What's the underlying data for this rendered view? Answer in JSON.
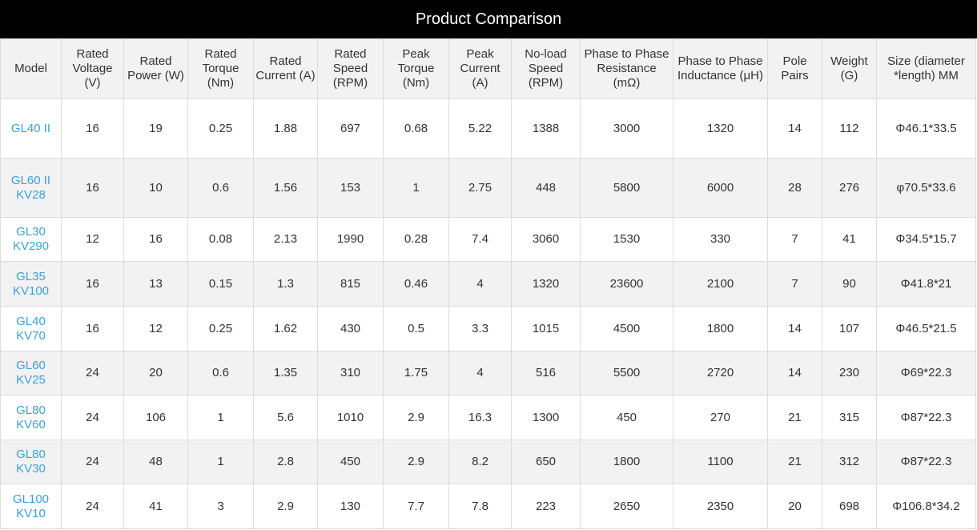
{
  "title": "Product Comparison",
  "colors": {
    "header_bg": "#000000",
    "model_link": "#3aa0d8",
    "stripe": "#f2f2f2"
  },
  "columns": [
    "Model",
    "Rated Voltage (V)",
    "Rated Power (W)",
    "Rated Torque (Nm)",
    "Rated Current (A)",
    "Rated Speed (RPM)",
    "Peak Torque (Nm)",
    "Peak Current (A)",
    "No-load Speed (RPM)",
    "Phase to Phase Resistance (mΩ)",
    "Phase to Phase Inductance (μH)",
    "Pole Pairs",
    "Weight (G)",
    "Size (diameter *length) MM"
  ],
  "rows": [
    [
      "GL40 II",
      "16",
      "19",
      "0.25",
      "1.88",
      "697",
      "0.68",
      "5.22",
      "1388",
      "3000",
      "1320",
      "14",
      "112",
      "Φ46.1*33.5"
    ],
    [
      "GL60 II KV28",
      "16",
      "10",
      "0.6",
      "1.56",
      "153",
      "1",
      "2.75",
      "448",
      "5800",
      "6000",
      "28",
      "276",
      "φ70.5*33.6"
    ],
    [
      "GL30 KV290",
      "12",
      "16",
      "0.08",
      "2.13",
      "1990",
      "0.28",
      "7.4",
      "3060",
      "1530",
      "330",
      "7",
      "41",
      "Φ34.5*15.7"
    ],
    [
      "GL35 KV100",
      "16",
      "13",
      "0.15",
      "1.3",
      "815",
      "0.46",
      "4",
      "1320",
      "23600",
      "2100",
      "7",
      "90",
      "Φ41.8*21"
    ],
    [
      "GL40 KV70",
      "16",
      "12",
      "0.25",
      "1.62",
      "430",
      "0.5",
      "3.3",
      "1015",
      "4500",
      "1800",
      "14",
      "107",
      "Φ46.5*21.5"
    ],
    [
      "GL60 KV25",
      "24",
      "20",
      "0.6",
      "1.35",
      "310",
      "1.75",
      "4",
      "516",
      "5500",
      "2720",
      "14",
      "230",
      "Φ69*22.3"
    ],
    [
      "GL80 KV60",
      "24",
      "106",
      "1",
      "5.6",
      "1010",
      "2.9",
      "16.3",
      "1300",
      "450",
      "270",
      "21",
      "315",
      "Φ87*22.3"
    ],
    [
      "GL80 KV30",
      "24",
      "48",
      "1",
      "2.8",
      "450",
      "2.9",
      "8.2",
      "650",
      "1800",
      "1100",
      "21",
      "312",
      "Φ87*22.3"
    ],
    [
      "GL100 KV10",
      "24",
      "41",
      "3",
      "2.9",
      "130",
      "7.7",
      "7.8",
      "223",
      "2650",
      "2350",
      "20",
      "698",
      "Φ106.8*34.2"
    ]
  ]
}
